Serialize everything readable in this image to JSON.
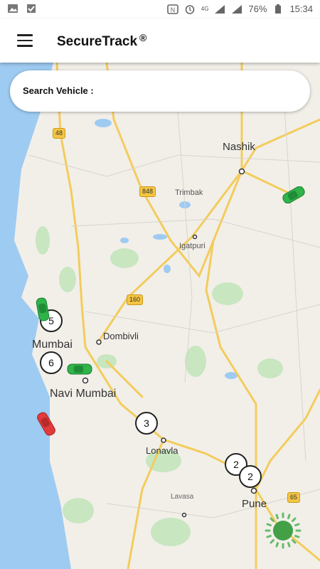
{
  "status_bar": {
    "network": "4G",
    "battery": "76%",
    "time": "15:34"
  },
  "app": {
    "title": "SecureTrack",
    "mark": "®"
  },
  "search": {
    "label": "Search Vehicle :"
  },
  "map": {
    "cities": [
      {
        "name": "Nashik"
      },
      {
        "name": "Trimbak"
      },
      {
        "name": "Igatpuri"
      },
      {
        "name": "Dombivli"
      },
      {
        "name": "Mumbai"
      },
      {
        "name": "Navi Mumbai"
      },
      {
        "name": "Lonavla"
      },
      {
        "name": "Lavasa"
      },
      {
        "name": "Pune"
      }
    ],
    "highways": [
      "48",
      "848",
      "160",
      "65"
    ],
    "clusters": [
      "5",
      "6",
      "3",
      "2",
      "2"
    ]
  },
  "colors": {
    "water": "#9ecbf2",
    "road": "#f3cc5c",
    "car_green": "#2fb34a",
    "car_red": "#e23b3b",
    "fab": "#43a047"
  },
  "icons": [
    "image-icon",
    "check-icon",
    "nfc-icon",
    "alarm-icon",
    "signal-icon",
    "battery-icon",
    "menu-icon",
    "car-icon",
    "location-dot-icon"
  ]
}
